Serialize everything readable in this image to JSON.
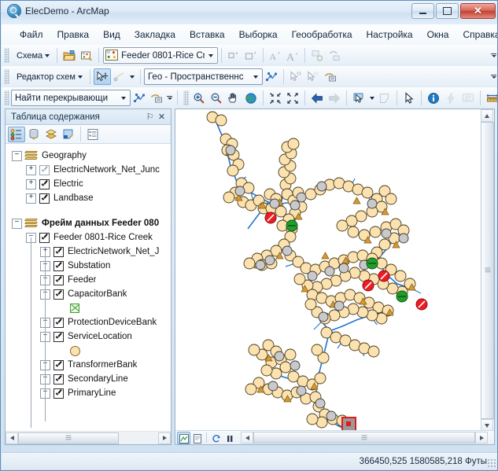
{
  "window": {
    "title": "ElecDemo - ArcMap",
    "app_icon": "arcmap-globe-icon",
    "minimize_label": "–",
    "maximize_label": "□",
    "close_label": "✕"
  },
  "menubar": {
    "items": [
      {
        "label": "Файл",
        "name": "menu-file"
      },
      {
        "label": "Правка",
        "name": "menu-edit"
      },
      {
        "label": "Вид",
        "name": "menu-view"
      },
      {
        "label": "Закладка",
        "name": "menu-bookmarks"
      },
      {
        "label": "Вставка",
        "name": "menu-insert"
      },
      {
        "label": "Выборка",
        "name": "menu-selection"
      },
      {
        "label": "Геообработка",
        "name": "menu-geoprocessing"
      },
      {
        "label": "Настройка",
        "name": "menu-customize"
      },
      {
        "label": "Окна",
        "name": "menu-windows"
      },
      {
        "label": "Справка",
        "name": "menu-help"
      }
    ]
  },
  "toolbar_schematic": {
    "menu_label": "Схема",
    "open_diagram_tooltip": "open-diagram",
    "save_diagram_tooltip": "save-diagram",
    "diagram_combo_value": "Feeder 0801-Rice Cre",
    "buttons": [
      {
        "name": "zoom-to-selected-button"
      },
      {
        "name": "zoom-to-diagram-button"
      },
      {
        "name": "decrease-font-button"
      },
      {
        "name": "increase-font-button"
      },
      {
        "name": "refresh-diagram-button"
      },
      {
        "name": "diagram-properties-button"
      }
    ]
  },
  "toolbar_editor": {
    "menu_label": "Редактор схем",
    "move_tool_name": "move-tool",
    "sketch_tool_name": "sketch-tool",
    "layout_combo_value": "Гео - Пространственнс",
    "apply_layout_name": "apply-layout-button",
    "select_tool_name": "select-feature-tool",
    "unselect_tool_name": "unselect-feature-tool",
    "properties_name": "editor-properties-button"
  },
  "toolbar_find": {
    "combo_value": "Найти перекрывающи",
    "network_button": "network-analysis-button",
    "report_button": "report-button"
  },
  "toolbar_tools": {
    "buttons": [
      {
        "name": "zoom-in-tool",
        "icon": "magnifier-plus-icon"
      },
      {
        "name": "zoom-out-tool",
        "icon": "magnifier-minus-icon"
      },
      {
        "name": "pan-tool",
        "icon": "hand-icon"
      },
      {
        "name": "full-extent-tool",
        "icon": "globe-icon"
      },
      {
        "name": "fixed-zoom-in-button",
        "icon": "arrows-in-icon"
      },
      {
        "name": "fixed-zoom-out-button",
        "icon": "arrows-out-icon"
      },
      {
        "name": "go-back-extent-button",
        "icon": "arrow-left-icon"
      },
      {
        "name": "go-forward-extent-button",
        "icon": "arrow-right-icon"
      },
      {
        "name": "select-features-tool",
        "icon": "select-arrow-icon"
      },
      {
        "name": "select-by-polygon-button",
        "icon": "polygon-select-icon"
      },
      {
        "name": "select-elements-tool",
        "icon": "pointer-icon"
      },
      {
        "name": "identify-tool",
        "icon": "info-circle-icon"
      },
      {
        "name": "hyperlink-tool",
        "icon": "lightning-icon"
      },
      {
        "name": "html-popup-tool",
        "icon": "speech-bubble-icon"
      },
      {
        "name": "measure-tool",
        "icon": "ruler-icon"
      }
    ]
  },
  "toc": {
    "title": "Таблица содержания",
    "pin_label": "⚐",
    "close_label": "✕",
    "tool_buttons": [
      {
        "name": "list-by-drawing-order-button",
        "pressed": true
      },
      {
        "name": "list-by-source-button",
        "pressed": false
      },
      {
        "name": "list-by-visibility-button",
        "pressed": false
      },
      {
        "name": "list-by-selection-button",
        "pressed": false
      },
      {
        "name": "toc-options-button",
        "pressed": false
      }
    ],
    "tree": [
      {
        "label": "Geography",
        "type": "dataframe",
        "indent": 0,
        "expander": "minus",
        "bold": false
      },
      {
        "label": "ElectricNetwork_Net_Junc",
        "type": "layer",
        "indent": 1,
        "expander": "plus",
        "checked": true,
        "dimmed": true
      },
      {
        "label": "Electric",
        "type": "layer",
        "indent": 1,
        "expander": "plus",
        "checked": true,
        "dimmed": false
      },
      {
        "label": "Landbase",
        "type": "layer",
        "indent": 1,
        "expander": "plus",
        "checked": true,
        "dimmed": false
      },
      {
        "label": "Фрейм данных Feeder 080",
        "type": "dataframe",
        "indent": 0,
        "expander": "minus",
        "bold": true
      },
      {
        "label": "Feeder 0801-Rice Creek",
        "type": "group",
        "indent": 1,
        "expander": "minus",
        "checked": true
      },
      {
        "label": "ElectricNetwork_Net_J",
        "type": "layer",
        "indent": 2,
        "expander": "plus",
        "checked": true
      },
      {
        "label": "Substation",
        "type": "layer",
        "indent": 2,
        "expander": "plus",
        "checked": true
      },
      {
        "label": "Feeder",
        "type": "layer",
        "indent": 2,
        "expander": "plus",
        "checked": true
      },
      {
        "label": "CapacitorBank",
        "type": "layer",
        "indent": 2,
        "expander": "minus",
        "checked": true
      },
      {
        "label": "",
        "type": "symbol-capacitor",
        "indent": 3
      },
      {
        "label": "ProtectionDeviceBank",
        "type": "layer",
        "indent": 2,
        "expander": "plus",
        "checked": true
      },
      {
        "label": "ServiceLocation",
        "type": "layer",
        "indent": 2,
        "expander": "minus",
        "checked": true
      },
      {
        "label": "",
        "type": "symbol-service",
        "indent": 3
      },
      {
        "label": "TransformerBank",
        "type": "layer",
        "indent": 2,
        "expander": "plus",
        "checked": true
      },
      {
        "label": "SecondaryLine",
        "type": "layer",
        "indent": 2,
        "expander": "plus",
        "checked": true
      },
      {
        "label": "PrimaryLine",
        "type": "layer",
        "indent": 2,
        "expander": "plus",
        "checked": true
      }
    ]
  },
  "map": {
    "colors": {
      "service_location_fill": "#fbe2b0",
      "service_location_stroke": "#4a3a18",
      "junction_fill": "#c9c9c9",
      "junction_stroke": "#3c3c3c",
      "capacitor_fill": "#1f9e2a",
      "protection_device_fill": "#ee1b24",
      "transformer_fill": "#d99a2b",
      "primary_line": "#1f76d2",
      "substation_fill": "#9a9a9a",
      "substation_stroke": "#e01b1b",
      "selection_halo": "#9ecff5"
    },
    "bottom_buttons": [
      {
        "name": "data-view-button",
        "pressed": true
      },
      {
        "name": "layout-view-button",
        "pressed": false
      },
      {
        "name": "refresh-view-button",
        "pressed": false
      },
      {
        "name": "pause-drawing-button",
        "pressed": false
      }
    ]
  },
  "statusbar": {
    "coordinates": "366450,525  1580585,218 Футы"
  }
}
